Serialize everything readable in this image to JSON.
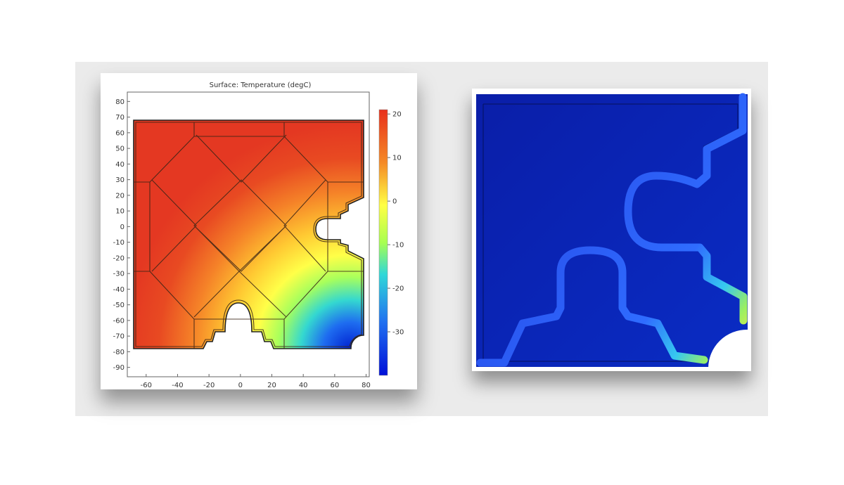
{
  "chart_data": [
    {
      "type": "heatmap",
      "title": "Surface: Temperature (degC)",
      "xlabel": "",
      "ylabel": "",
      "xlim": [
        -72,
        82
      ],
      "ylim": [
        -96,
        86
      ],
      "x_ticks": [
        -60,
        -40,
        -20,
        0,
        20,
        40,
        60,
        80
      ],
      "y_ticks": [
        80,
        70,
        60,
        50,
        40,
        30,
        20,
        10,
        0,
        -10,
        -20,
        -30,
        -40,
        -50,
        -60,
        -70,
        -80,
        -90
      ],
      "colorbar": {
        "min": -40,
        "max": 21,
        "ticks": [
          20,
          10,
          0,
          -10,
          -20,
          -30
        ],
        "colormap": "rainbow"
      },
      "field": {
        "hot_value": 20,
        "cold_value": -38,
        "cold_corner": [
          80,
          -80
        ]
      },
      "grid": false,
      "colors": {
        "hot": "#e83a20",
        "mid": "#ffff44",
        "cold": "#1a34d8"
      }
    },
    {
      "type": "heatmap",
      "title": "",
      "colors": {
        "background": "#0a25b5",
        "channel": "#2f63ff",
        "hot": "#ffe040"
      }
    }
  ]
}
